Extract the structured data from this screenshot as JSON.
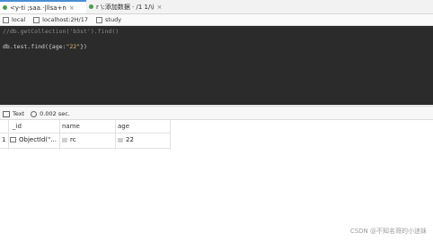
{
  "tabs": [
    {
      "label": "<y-ti ;saa.·|llsa+n",
      "close": "×"
    },
    {
      "label": "r \\:添加数据 · /1 1/\\i",
      "close": "×"
    }
  ],
  "connection": {
    "host": "local",
    "server": "localhost:2H/17",
    "database": "study"
  },
  "editor": {
    "line1": "//db.getCollection('b3st').find()",
    "line2_prefix": "db.test.find(",
    "line2_arg_open": "{age:",
    "line2_string": "\"22\"",
    "line2_suffix": "})"
  },
  "results_bar": {
    "view_label": "Text",
    "time": "0.002 sec."
  },
  "grid": {
    "headers": [
      "_id",
      "name",
      "age"
    ],
    "rows": [
      {
        "num": "1",
        "_id": "ObjectId(\"...",
        "name": "rc",
        "age": "22"
      }
    ]
  },
  "watermark": "CSDN @不知名哥的小迷妹"
}
